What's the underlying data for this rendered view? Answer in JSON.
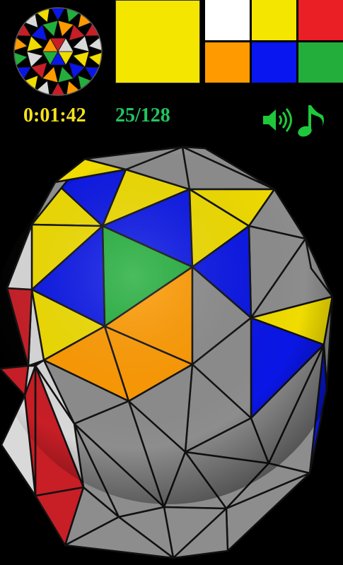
{
  "hud": {
    "timer": "0:01:42",
    "progress": "25/128",
    "timer_color": "#f5e21b",
    "progress_color": "#22c55e"
  },
  "selected_color": "#f5e600",
  "palette": [
    {
      "name": "white",
      "hex": "#ffffff"
    },
    {
      "name": "yellow",
      "hex": "#f5e600"
    },
    {
      "name": "red",
      "hex": "#ea1f25"
    },
    {
      "name": "orange",
      "hex": "#ff9a00"
    },
    {
      "name": "blue",
      "hex": "#0a16f0"
    },
    {
      "name": "green",
      "hex": "#23ae3c"
    }
  ],
  "icons": {
    "sound": "speaker-icon",
    "music": "music-note-icon",
    "icon_color": "#1ec83a"
  },
  "puzzle_colors": {
    "gray": "#8d8d8d",
    "white": "#d9d9d9",
    "yellow": "#f0dc00",
    "blue": "#0a16e6",
    "green": "#23ae3c",
    "orange": "#ff9a00",
    "red": "#c81e26"
  }
}
